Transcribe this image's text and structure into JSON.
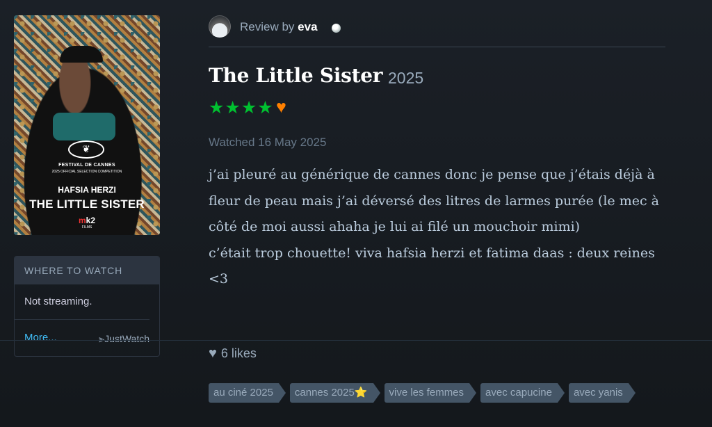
{
  "poster": {
    "festival": "FESTIVAL DE CANNES",
    "festival_sub": "2025 OFFICIAL SELECTION COMPETITION",
    "actor": "HAFSIA HERZI",
    "title": "THE LITTLE SISTER",
    "studio_a": "m",
    "studio_b": "k2",
    "studio_sub": "FILMS"
  },
  "where_to_watch": {
    "heading": "WHERE TO WATCH",
    "status": "Not streaming.",
    "more": "More...",
    "provider": "⫸JustWatch"
  },
  "review": {
    "prefix": "Review by",
    "author": "eva",
    "film_title": "The Little Sister",
    "year": "2025",
    "rating_stars": "★★★★",
    "liked_icon": "♥",
    "watched": "Watched 16 May 2025",
    "body_lines": [
      "j’ai pleuré au générique de cannes donc je pense que j’étais déjà à fleur de peau mais j’ai déversé des litres de larmes purée (le mec à côté de moi aussi ahaha je lui ai filé un mouchoir mimi)",
      "c’était trop chouette! viva hafsia herzi et fatima daas : deux reines <3"
    ],
    "likes": "6 likes"
  },
  "tags": [
    {
      "label": "au ciné 2025"
    },
    {
      "label": "cannes 2025",
      "emoji": "⭐"
    },
    {
      "label": "vive les femmes"
    },
    {
      "label": "avec capucine"
    },
    {
      "label": "avec yanis"
    }
  ],
  "colors": {
    "background": "#14181c",
    "star_green": "#00c030",
    "like_orange": "#ff8000",
    "link_blue": "#40bcf4",
    "tag_bg": "#445566"
  }
}
